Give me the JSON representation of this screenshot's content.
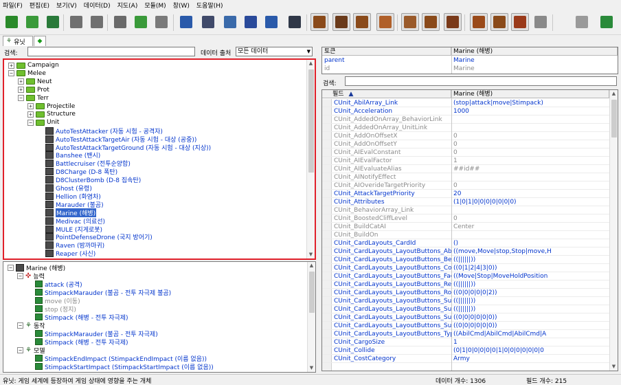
{
  "menu": [
    "파일(F)",
    "편집(E)",
    "보기(V)",
    "데이터(D)",
    "지도(A)",
    "모듈(M)",
    "창(W)",
    "도움말(H)"
  ],
  "tabs": {
    "units_label": "유닛"
  },
  "search": {
    "label": "검색:",
    "value": "",
    "source_label": "데이터 출처",
    "source_value": "모든 데이터"
  },
  "tree": [
    {
      "depth": 0,
      "exp": "+",
      "kind": "folder",
      "label": "Campaign",
      "style": ""
    },
    {
      "depth": 0,
      "exp": "−",
      "kind": "folder",
      "label": "Melee",
      "style": ""
    },
    {
      "depth": 1,
      "exp": "+",
      "kind": "folder",
      "label": "Neut",
      "style": ""
    },
    {
      "depth": 1,
      "exp": "+",
      "kind": "folder",
      "label": "Prot",
      "style": ""
    },
    {
      "depth": 1,
      "exp": "−",
      "kind": "folder",
      "label": "Terr",
      "style": ""
    },
    {
      "depth": 2,
      "exp": "+",
      "kind": "folder",
      "label": "Projectile",
      "style": ""
    },
    {
      "depth": 2,
      "exp": "+",
      "kind": "folder",
      "label": "Structure",
      "style": ""
    },
    {
      "depth": 2,
      "exp": "−",
      "kind": "folder",
      "label": "Unit",
      "style": ""
    },
    {
      "depth": 3,
      "exp": "",
      "kind": "unit",
      "label": "AutoTestAttacker (자동 시험 - 공격자)",
      "style": "blue"
    },
    {
      "depth": 3,
      "exp": "",
      "kind": "unit",
      "label": "AutoTestAttackTargetAir (자동 시험 - 대상 (공중))",
      "style": "blue"
    },
    {
      "depth": 3,
      "exp": "",
      "kind": "unit",
      "label": "AutoTestAttackTargetGround (자동 시험 - 대상 (지상))",
      "style": "blue"
    },
    {
      "depth": 3,
      "exp": "",
      "kind": "unit",
      "label": "Banshee (밴시)",
      "style": "blue"
    },
    {
      "depth": 3,
      "exp": "",
      "kind": "unit",
      "label": "Battlecruiser (전투순양함)",
      "style": "blue"
    },
    {
      "depth": 3,
      "exp": "",
      "kind": "unit",
      "label": "D8Charge (D-8 폭탄)",
      "style": "blue"
    },
    {
      "depth": 3,
      "exp": "",
      "kind": "unit",
      "label": "D8ClusterBomb (D-8 집속탄)",
      "style": "blue"
    },
    {
      "depth": 3,
      "exp": "",
      "kind": "unit",
      "label": "Ghost (유령)",
      "style": "blue"
    },
    {
      "depth": 3,
      "exp": "",
      "kind": "unit",
      "label": "Hellion (화염차)",
      "style": "blue"
    },
    {
      "depth": 3,
      "exp": "",
      "kind": "unit",
      "label": "Marauder (불곰)",
      "style": "blue"
    },
    {
      "depth": 3,
      "exp": "",
      "kind": "unit",
      "label": "Marine (해병)",
      "style": "sel"
    },
    {
      "depth": 3,
      "exp": "",
      "kind": "unit",
      "label": "Medivac (의료선)",
      "style": "blue"
    },
    {
      "depth": 3,
      "exp": "",
      "kind": "unit",
      "label": "MULE (지게로봇)",
      "style": "blue"
    },
    {
      "depth": 3,
      "exp": "",
      "kind": "unit",
      "label": "PointDefenseDrone (국지 방어기)",
      "style": "blue"
    },
    {
      "depth": 3,
      "exp": "",
      "kind": "unit",
      "label": "Raven (밤까마귀)",
      "style": "blue"
    },
    {
      "depth": 3,
      "exp": "",
      "kind": "unit",
      "label": "Reaper (사신)",
      "style": "blue"
    }
  ],
  "detail_tree": [
    {
      "depth": 0,
      "exp": "−",
      "kind": "unit",
      "label": "Marine (해병)",
      "style": ""
    },
    {
      "depth": 1,
      "exp": "−",
      "kind": "ability",
      "label": "능력",
      "style": ""
    },
    {
      "depth": 2,
      "exp": "",
      "kind": "item",
      "label": "attack (공격)",
      "style": "blue"
    },
    {
      "depth": 2,
      "exp": "",
      "kind": "item",
      "label": "StimpackMarauder (불곰 - 전투 자극제 불곰)",
      "style": "blue"
    },
    {
      "depth": 2,
      "exp": "",
      "kind": "item",
      "label": "move (이동)",
      "style": "gray"
    },
    {
      "depth": 2,
      "exp": "",
      "kind": "item",
      "label": "stop (정지)",
      "style": "gray"
    },
    {
      "depth": 2,
      "exp": "",
      "kind": "item",
      "label": "Stimpack (해병 - 전투 자극제)",
      "style": "blue"
    },
    {
      "depth": 1,
      "exp": "−",
      "kind": "action",
      "label": "동작",
      "style": ""
    },
    {
      "depth": 2,
      "exp": "",
      "kind": "item",
      "label": "StimpackMarauder (불곰 - 전투 자극제)",
      "style": "blue"
    },
    {
      "depth": 2,
      "exp": "",
      "kind": "item",
      "label": "Stimpack (해병 - 전투 자극제)",
      "style": "blue"
    },
    {
      "depth": 1,
      "exp": "−",
      "kind": "action",
      "label": "모델",
      "style": ""
    },
    {
      "depth": 2,
      "exp": "",
      "kind": "item",
      "label": "StimpackEndImpact (StimpackEndImpact (이름 없음))",
      "style": "blue"
    },
    {
      "depth": 2,
      "exp": "",
      "kind": "item",
      "label": "StimpackStartImpact (StimpackStartImpact (이름 없음))",
      "style": "blue"
    }
  ],
  "token_table": {
    "header": [
      "토큰",
      "Marine (해병)"
    ],
    "rows": [
      {
        "key": "parent",
        "value": "Marine",
        "style": "blue"
      },
      {
        "key": "id",
        "value": "Marine",
        "style": "gray"
      }
    ]
  },
  "field_search": {
    "label": "검색:",
    "value": ""
  },
  "field_table": {
    "header": [
      "필드",
      "Marine (해병)"
    ],
    "rows": [
      {
        "f": "CUnit_AbilArray_Link",
        "v": "(stop|attack|move|Stimpack)",
        "s": "blue"
      },
      {
        "f": "CUnit_Acceleration",
        "v": "1000",
        "s": "blue"
      },
      {
        "f": "CUnit_AddedOnArray_BehaviorLink",
        "v": "",
        "s": "gray"
      },
      {
        "f": "CUnit_AddedOnArray_UnitLink",
        "v": "",
        "s": "gray"
      },
      {
        "f": "CUnit_AddOnOffsetX",
        "v": "0",
        "s": "gray"
      },
      {
        "f": "CUnit_AddOnOffsetY",
        "v": "0",
        "s": "gray"
      },
      {
        "f": "CUnit_AIEvalConstant",
        "v": "0",
        "s": "gray"
      },
      {
        "f": "CUnit_AIEvalFactor",
        "v": "1",
        "s": "gray"
      },
      {
        "f": "CUnit_AIEvaluateAlias",
        "v": "##id##",
        "s": "gray"
      },
      {
        "f": "CUnit_AINotifyEffect",
        "v": "",
        "s": "gray"
      },
      {
        "f": "CUnit_AIOverideTargetPriority",
        "v": "0",
        "s": "gray"
      },
      {
        "f": "CUnit_AttackTargetPriority",
        "v": "20",
        "s": "blue"
      },
      {
        "f": "CUnit_Attributes",
        "v": "(1|0|1|0|0|0|0|0|0|0)",
        "s": "blue"
      },
      {
        "f": "CUnit_BehaviorArray_Link",
        "v": "",
        "s": "gray"
      },
      {
        "f": "CUnit_BoostedCliffLevel",
        "v": "0",
        "s": "gray"
      },
      {
        "f": "CUnit_BuildCatAI",
        "v": "Center",
        "s": "gray"
      },
      {
        "f": "CUnit_BuildOn",
        "v": "",
        "s": "gray"
      },
      {
        "f": "CUnit_CardLayouts_CardId",
        "v": "()",
        "s": "blue"
      },
      {
        "f": "CUnit_CardLayouts_LayoutButtons_Abil",
        "v": "((move,Move|stop,Stop|move,H",
        "s": "blue"
      },
      {
        "f": "CUnit_CardLayouts_LayoutButtons_Beh",
        "v": "((||||||))",
        "s": "blue"
      },
      {
        "f": "CUnit_CardLayouts_LayoutButtons_Col",
        "v": "((0|1|2|4|3|0))",
        "s": "blue"
      },
      {
        "f": "CUnit_CardLayouts_LayoutButtons_Fac",
        "v": "((Move|Stop|MoveHoldPosition",
        "s": "blue"
      },
      {
        "f": "CUnit_CardLayouts_LayoutButtons_Req",
        "v": "((||||||))",
        "s": "blue"
      },
      {
        "f": "CUnit_CardLayouts_LayoutButtons_Row",
        "v": "((0|0|0|0|0|2))",
        "s": "blue"
      },
      {
        "f": "CUnit_CardLayouts_LayoutButtons_Sub",
        "v": "((||||||))",
        "s": "blue"
      },
      {
        "f": "CUnit_CardLayouts_LayoutButtons_Sub",
        "v": "((||||||))",
        "s": "blue"
      },
      {
        "f": "CUnit_CardLayouts_LayoutButtons_Sub",
        "v": "((0|0|0|0|0|0))",
        "s": "blue"
      },
      {
        "f": "CUnit_CardLayouts_LayoutButtons_Sub",
        "v": "((0|0|0|0|0|0))",
        "s": "blue"
      },
      {
        "f": "CUnit_CardLayouts_LayoutButtons_Typ",
        "v": "((AbilCmd|AbilCmd|AbilCmd|A",
        "s": "blue"
      },
      {
        "f": "CUnit_CargoSize",
        "v": "1",
        "s": "blue"
      },
      {
        "f": "CUnit_Collide",
        "v": "(0|1|0|0|0|0|0|1|0|0|0|0|0|0|0",
        "s": "blue"
      },
      {
        "f": "CUnit_CostCategory",
        "v": "Army",
        "s": "blue"
      }
    ]
  },
  "status": {
    "message": "유닛: 게임 세계에 등장하여 게임 상태에 영향을 주는 개체",
    "data_count": "데이터 개수: 1306",
    "field_count": "필드 개수: 215"
  },
  "colors": {
    "highlight_border": "#e0202a",
    "link_blue": "#0033cc",
    "selection": "#3366cc"
  },
  "toolbar_icons": [
    "new-icon",
    "open-icon",
    "save-icon",
    "undo-icon",
    "redo-icon",
    "cut-icon",
    "copy-icon",
    "paste-icon",
    "terrain-icon",
    "triggers-icon",
    "data-icon",
    "text-icon",
    "import-icon",
    "cutscene-icon",
    "tool-a-icon",
    "tool-b-icon",
    "tool-c-icon",
    "tool-d-icon",
    "tool-e-icon",
    "tool-f-icon",
    "tool-g-icon",
    "tool-h-icon",
    "tool-i-icon",
    "tool-j-icon",
    "tool-k-icon",
    "tool-l-icon",
    "test-icon"
  ]
}
